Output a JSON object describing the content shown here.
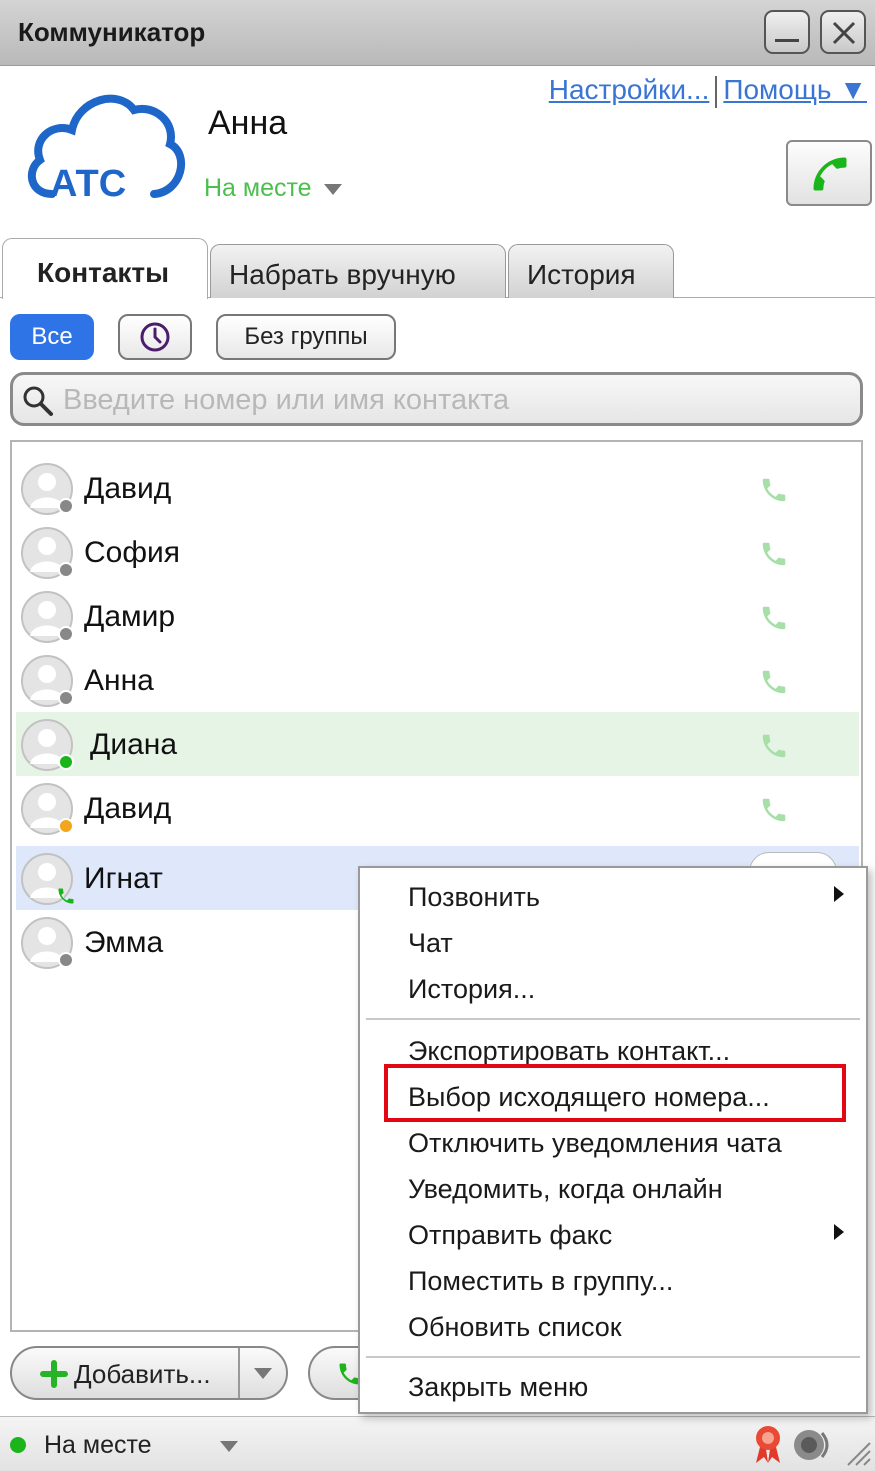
{
  "window": {
    "title": "Коммуникатор"
  },
  "header": {
    "logo_text": "АТС",
    "user_name": "Анна",
    "status": "На месте",
    "settings_link": "Настройки...",
    "help_link": "Помощь ▼"
  },
  "tabs": [
    {
      "label": "Контакты",
      "active": true
    },
    {
      "label": "Набрать вручную",
      "active": false
    },
    {
      "label": "История",
      "active": false
    }
  ],
  "filters": {
    "all": "Все",
    "recent_icon": "clock-icon",
    "no_group": "Без группы"
  },
  "search": {
    "placeholder": "Введите номер или имя контакта",
    "value": ""
  },
  "contacts": [
    {
      "name": "Давид",
      "status": "offline",
      "status_color": "#888888"
    },
    {
      "name": "София",
      "status": "offline",
      "status_color": "#888888"
    },
    {
      "name": "Дамир",
      "status": "offline",
      "status_color": "#888888"
    },
    {
      "name": "Анна",
      "status": "offline",
      "status_color": "#888888"
    },
    {
      "name": "Диана",
      "status": "online",
      "status_color": "#1bb51b",
      "highlighted": true
    },
    {
      "name": "Давид",
      "status": "away",
      "status_color": "#f3a51c"
    },
    {
      "name": "Игнат",
      "status": "on-call",
      "status_color": "#1bb51b",
      "selected": true
    },
    {
      "name": "Эмма",
      "status": "offline",
      "status_color": "#888888"
    }
  ],
  "bottom": {
    "add_button": "Добавить..."
  },
  "statusbar": {
    "status": "На месте",
    "status_color": "#1bb51b"
  },
  "context_menu": {
    "group1": [
      {
        "label": "Позвонить",
        "submenu": true
      },
      {
        "label": "Чат",
        "submenu": false
      },
      {
        "label": "История...",
        "submenu": false
      }
    ],
    "group2": [
      {
        "label": "Экспортировать контакт...",
        "submenu": false
      },
      {
        "label": "Выбор исходящего номера...",
        "submenu": false,
        "highlighted": true
      },
      {
        "label": "Отключить уведомления чата",
        "submenu": false
      },
      {
        "label": "Уведомить, когда онлайн",
        "submenu": false
      },
      {
        "label": "Отправить факс",
        "submenu": true
      },
      {
        "label": "Поместить в группу...",
        "submenu": false
      },
      {
        "label": "Обновить список",
        "submenu": false
      }
    ],
    "group3": [
      {
        "label": "Закрыть меню",
        "submenu": false
      }
    ]
  },
  "colors": {
    "accent": "#2e74e6",
    "link": "#3a75d4",
    "online": "#1bb51b",
    "away": "#f3a51c",
    "highlight_frame": "#e30613",
    "phone_light": "#a8dfa8"
  }
}
